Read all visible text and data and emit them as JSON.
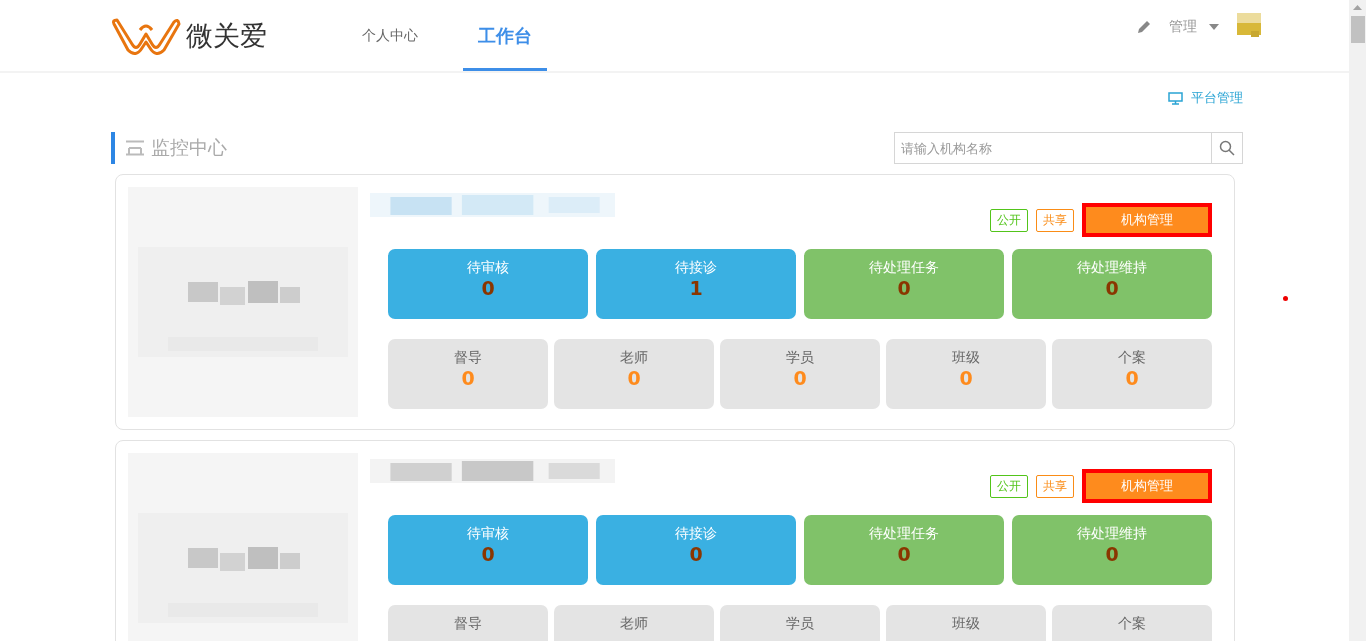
{
  "header": {
    "brand": "微关爱",
    "nav": [
      {
        "label": "个人中心",
        "selected": false
      },
      {
        "label": "工作台",
        "selected": true
      }
    ],
    "user_menu": "管理"
  },
  "platform_link": "平台管理",
  "section": {
    "title": "监控中心",
    "search": {
      "placeholder": "请输入机构名称"
    }
  },
  "orgs": [
    {
      "tags": [
        {
          "label": "公开",
          "color": "#52c41a"
        },
        {
          "label": "共享",
          "color": "#fa8c16"
        }
      ],
      "manage_button": "机构管理",
      "tasks": [
        {
          "label": "待审核",
          "value": "0",
          "color": "#3ab0e2"
        },
        {
          "label": "待接诊",
          "value": "1",
          "color": "#3ab0e2"
        },
        {
          "label": "待处理任务",
          "value": "0",
          "color": "#80c269"
        },
        {
          "label": "待处理维持",
          "value": "0",
          "color": "#80c269"
        }
      ],
      "stats": [
        {
          "label": "督导",
          "value": "0"
        },
        {
          "label": "老师",
          "value": "0"
        },
        {
          "label": "学员",
          "value": "0"
        },
        {
          "label": "班级",
          "value": "0"
        },
        {
          "label": "个案",
          "value": "0"
        }
      ]
    },
    {
      "tags": [
        {
          "label": "公开",
          "color": "#52c41a"
        },
        {
          "label": "共享",
          "color": "#fa8c16"
        }
      ],
      "manage_button": "机构管理",
      "tasks": [
        {
          "label": "待审核",
          "value": "0",
          "color": "#3ab0e2"
        },
        {
          "label": "待接诊",
          "value": "0",
          "color": "#3ab0e2"
        },
        {
          "label": "待处理任务",
          "value": "0",
          "color": "#80c269"
        },
        {
          "label": "待处理维持",
          "value": "0",
          "color": "#80c269"
        }
      ],
      "stats": [
        {
          "label": "督导"
        },
        {
          "label": "老师"
        },
        {
          "label": "学员"
        },
        {
          "label": "班级"
        },
        {
          "label": "个案"
        }
      ]
    }
  ]
}
